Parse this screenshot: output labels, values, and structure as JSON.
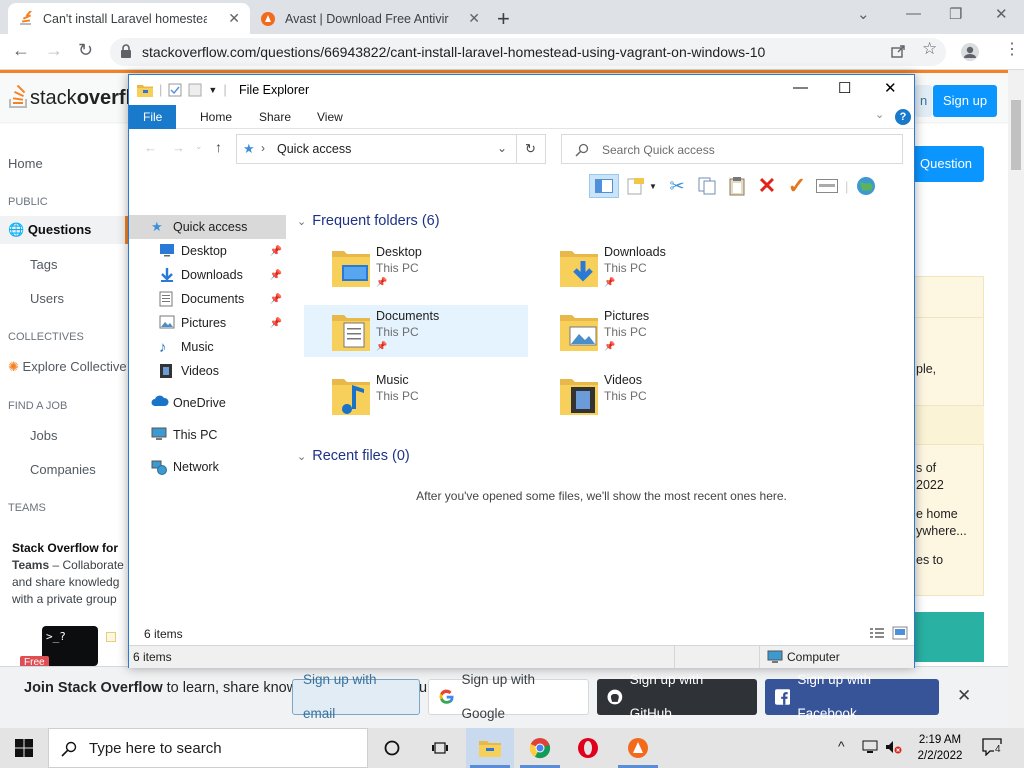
{
  "browser": {
    "tabs": [
      {
        "title": "Can't install Laravel homestead u",
        "active": true
      },
      {
        "title": "Avast | Download Free Antivirus",
        "active": false
      }
    ],
    "url": "stackoverflow.com/questions/66943822/cant-install-laravel-homestead-using-vagrant-on-windows-10"
  },
  "so": {
    "logo_light": "stack",
    "logo_bold": "overfl",
    "login_label": "n",
    "signup_label": "Sign up",
    "ask_label": "Question",
    "nav": {
      "home": "Home",
      "public": "PUBLIC",
      "questions": "Questions",
      "tags": "Tags",
      "users": "Users",
      "collectives": "COLLECTIVES",
      "explore": "Explore Collective",
      "find_job": "FIND A JOB",
      "jobs": "Jobs",
      "companies": "Companies",
      "teams": "TEAMS"
    },
    "teams_title": "Stack Overflow for",
    "teams_bold": "Teams",
    "teams_desc": " – Collaborate and share knowledg with a private group",
    "teams_badge": "Free",
    "sidebar_fragments": [
      "ple,",
      "s of",
      "2022",
      "e home",
      "ywhere...",
      "es to"
    ]
  },
  "banner": {
    "msg_bold": "Join Stack Overflow",
    "msg_rest": " to learn, share knowledge, and build your career.",
    "email": "Sign up with email",
    "google": "Sign up with Google",
    "github": "Sign up with GitHub",
    "facebook": "Sign up with Facebook"
  },
  "explorer": {
    "title": "File Explorer",
    "ribbon_tabs": [
      "File",
      "Home",
      "Share",
      "View"
    ],
    "address": "Quick access",
    "search_placeholder": "Search Quick access",
    "nav": [
      {
        "label": "Quick access",
        "icon": "star-icon",
        "pinned": false,
        "selected": true
      },
      {
        "label": "Desktop",
        "icon": "desktop-icon",
        "pinned": true
      },
      {
        "label": "Downloads",
        "icon": "download-icon",
        "pinned": true
      },
      {
        "label": "Documents",
        "icon": "document-icon",
        "pinned": true
      },
      {
        "label": "Pictures",
        "icon": "picture-icon",
        "pinned": true
      },
      {
        "label": "Music",
        "icon": "music-icon",
        "pinned": false
      },
      {
        "label": "Videos",
        "icon": "video-icon",
        "pinned": false
      },
      {
        "label": "OneDrive",
        "icon": "cloud-icon",
        "pinned": false
      },
      {
        "label": "This PC",
        "icon": "computer-icon",
        "pinned": false
      },
      {
        "label": "Network",
        "icon": "network-icon",
        "pinned": false
      }
    ],
    "frequent_header": "Frequent folders (6)",
    "folders": [
      {
        "name": "Desktop",
        "location": "This PC",
        "pinned": true
      },
      {
        "name": "Downloads",
        "location": "This PC",
        "pinned": true
      },
      {
        "name": "Documents",
        "location": "This PC",
        "pinned": true
      },
      {
        "name": "Pictures",
        "location": "This PC",
        "pinned": true
      },
      {
        "name": "Music",
        "location": "This PC",
        "pinned": false
      },
      {
        "name": "Videos",
        "location": "This PC",
        "pinned": false
      }
    ],
    "recent_header": "Recent files (0)",
    "recent_empty": "After you've opened some files, we'll show the most recent ones here.",
    "status_count": "6 items",
    "status_count2": "6 items",
    "status_location": "Computer"
  },
  "taskbar": {
    "search_placeholder": "Type here to search",
    "time": "2:19 AM",
    "date": "2/2/2022",
    "notifications": "4"
  }
}
